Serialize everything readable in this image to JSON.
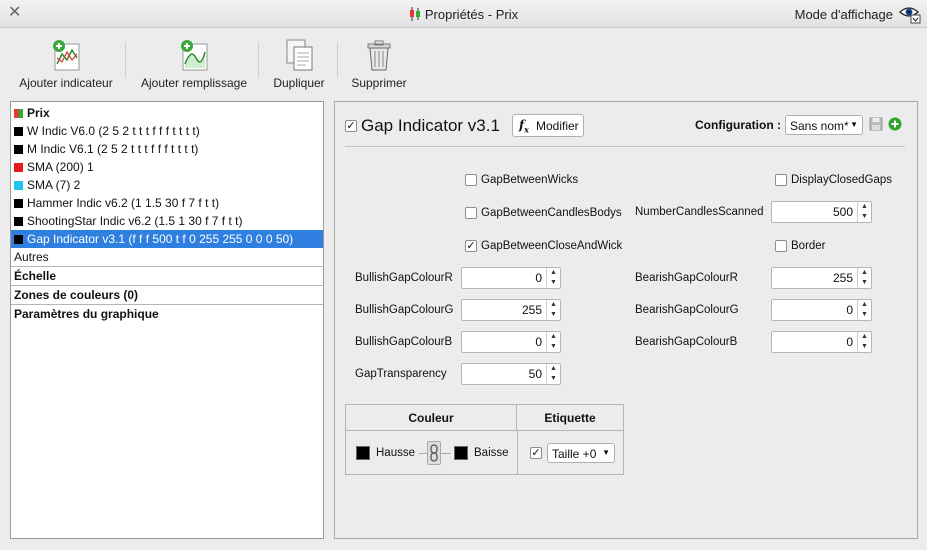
{
  "window": {
    "title": "Propriétés - Prix",
    "mode_label": "Mode d'affichage"
  },
  "toolbar": {
    "add_indicator": "Ajouter indicateur",
    "add_fill": "Ajouter remplissage",
    "duplicate": "Dupliquer",
    "delete": "Supprimer"
  },
  "tree": {
    "items": [
      {
        "label": "Prix",
        "color": "#3aa83a"
      },
      {
        "label": "W Indic V6.0 (2 5 2 t t t f f f t t t t)",
        "color": "#000000"
      },
      {
        "label": "M Indic V6.1 (2 5 2 t t t f f f t t t t)",
        "color": "#000000"
      },
      {
        "label": "SMA (200) 1",
        "color": "#e8181b"
      },
      {
        "label": "SMA (7) 2",
        "color": "#1ec6f0"
      },
      {
        "label": "Hammer Indic v6.2 (1 1.5 30 f 7 f t t)",
        "color": "#000000"
      },
      {
        "label": "ShootingStar Indic v6.2 (1.5 1 30 f 7 f t t)",
        "color": "#000000"
      },
      {
        "label": "Gap Indicator v3.1 (f f f 500 t f 0 255 255 0 0 0 50)",
        "color": "#000000"
      }
    ],
    "sections": [
      "Autres",
      "Échelle",
      "Zones de couleurs (0)",
      "Paramètres du graphique"
    ]
  },
  "indicator": {
    "name": "Gap Indicator v3.1",
    "modify_label": "Modifier",
    "config_label": "Configuration :",
    "config_value": "Sans nom*"
  },
  "params": {
    "gap_between_wicks": "GapBetweenWicks",
    "display_closed_gaps": "DisplayClosedGaps",
    "gap_between_candles_bodys": "GapBetweenCandlesBodys",
    "number_candles_scanned_label": "NumberCandlesScanned",
    "number_candles_scanned_value": "500",
    "gap_between_close_and_wick": "GapBetweenCloseAndWick",
    "border": "Border",
    "bullish_r_label": "BullishGapColourR",
    "bullish_r_value": "0",
    "bearish_r_label": "BearishGapColourR",
    "bearish_r_value": "255",
    "bullish_g_label": "BullishGapColourG",
    "bullish_g_value": "255",
    "bearish_g_label": "BearishGapColourG",
    "bearish_g_value": "0",
    "bullish_b_label": "BullishGapColourB",
    "bullish_b_value": "0",
    "bearish_b_label": "BearishGapColourB",
    "bearish_b_value": "0",
    "transparency_label": "GapTransparency",
    "transparency_value": "50"
  },
  "style_table": {
    "col_colour": "Couleur",
    "col_label": "Etiquette",
    "up_label": "Hausse",
    "down_label": "Baisse",
    "size_value": "Taille +0"
  }
}
